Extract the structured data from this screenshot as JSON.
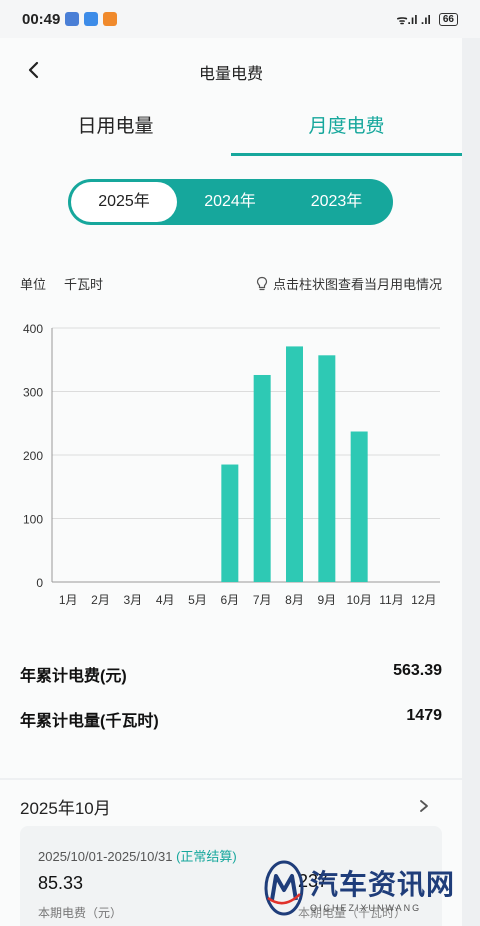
{
  "status_bar": {
    "time": "00:49",
    "signal": "ᯤ.ıl .ıl",
    "battery": "66"
  },
  "nav": {
    "title": "电量电费"
  },
  "tabs": [
    {
      "label": "日用电量"
    },
    {
      "label": "月度电费"
    }
  ],
  "years": [
    {
      "label": "2025年"
    },
    {
      "label": "2024年"
    },
    {
      "label": "2023年"
    }
  ],
  "unit": {
    "label": "单位",
    "value": "千瓦时",
    "hint": "点击柱状图查看当月用电情况"
  },
  "chart_data": {
    "type": "bar",
    "categories": [
      "1月",
      "2月",
      "3月",
      "4月",
      "5月",
      "6月",
      "7月",
      "8月",
      "9月",
      "10月",
      "11月",
      "12月"
    ],
    "values": [
      0,
      0,
      0,
      0,
      0,
      185,
      326,
      371,
      357,
      237,
      0,
      0
    ],
    "ylim": [
      0,
      400
    ],
    "yticks": [
      "0",
      "100",
      "200",
      "300",
      "400"
    ],
    "color": "#2ec9b4",
    "grid": true
  },
  "summary": {
    "fee_label": "年累计电费(元)",
    "fee_value": "563.39",
    "usage_label": "年累计电量(千瓦时)",
    "usage_value": "1479"
  },
  "month": {
    "title": "2025年10月",
    "period": "2025/10/01-2025/10/31",
    "status": "(正常结算)",
    "amount": "85.33",
    "amount_label": "本期电费（元）",
    "usage": "237",
    "usage_label": "本期电量（千瓦时）"
  },
  "watermark": {
    "main": "汽车资讯网",
    "sub": "QICHEZIXUNWANG"
  }
}
